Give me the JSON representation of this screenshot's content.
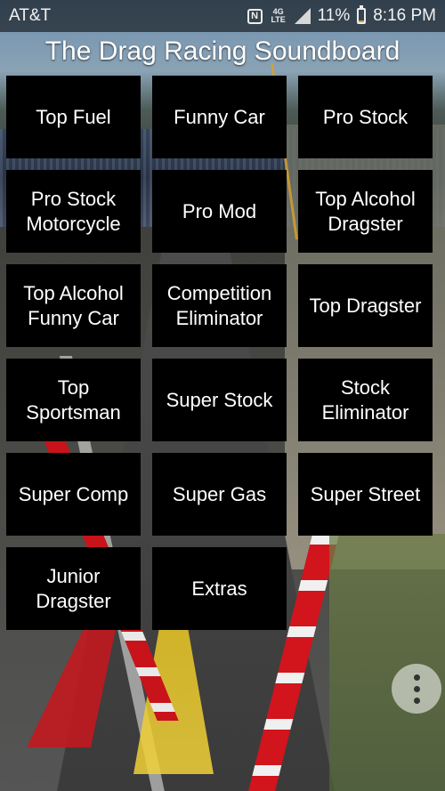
{
  "status_bar": {
    "carrier": "AT&T",
    "network_label": "4G LTE",
    "battery_percent": "11%",
    "time": "8:16 PM",
    "icons": [
      "nfc-icon",
      "lte-icon",
      "signal-icon",
      "battery-icon"
    ]
  },
  "app": {
    "title": "The Drag Racing Soundboard"
  },
  "buttons": [
    {
      "label": "Top Fuel"
    },
    {
      "label": "Funny Car"
    },
    {
      "label": "Pro Stock"
    },
    {
      "label": "Pro Stock\nMotorcycle"
    },
    {
      "label": "Pro Mod"
    },
    {
      "label": "Top Alcohol\nDragster"
    },
    {
      "label": "Top Alcohol\nFunny Car"
    },
    {
      "label": "Competition\nEliminator"
    },
    {
      "label": "Top Dragster"
    },
    {
      "label": "Top\nSportsman"
    },
    {
      "label": "Super Stock"
    },
    {
      "label": "Stock\nEliminator"
    },
    {
      "label": "Super Comp"
    },
    {
      "label": "Super Gas"
    },
    {
      "label": "Super Street"
    },
    {
      "label": "Junior\nDragster"
    },
    {
      "label": "Extras"
    }
  ],
  "fab": {
    "icon": "more-vertical-icon"
  },
  "colors": {
    "button_bg": "#000000",
    "button_text": "#ffffff",
    "title_text": "#ffffff",
    "battery_fill": "#d9a02d"
  }
}
